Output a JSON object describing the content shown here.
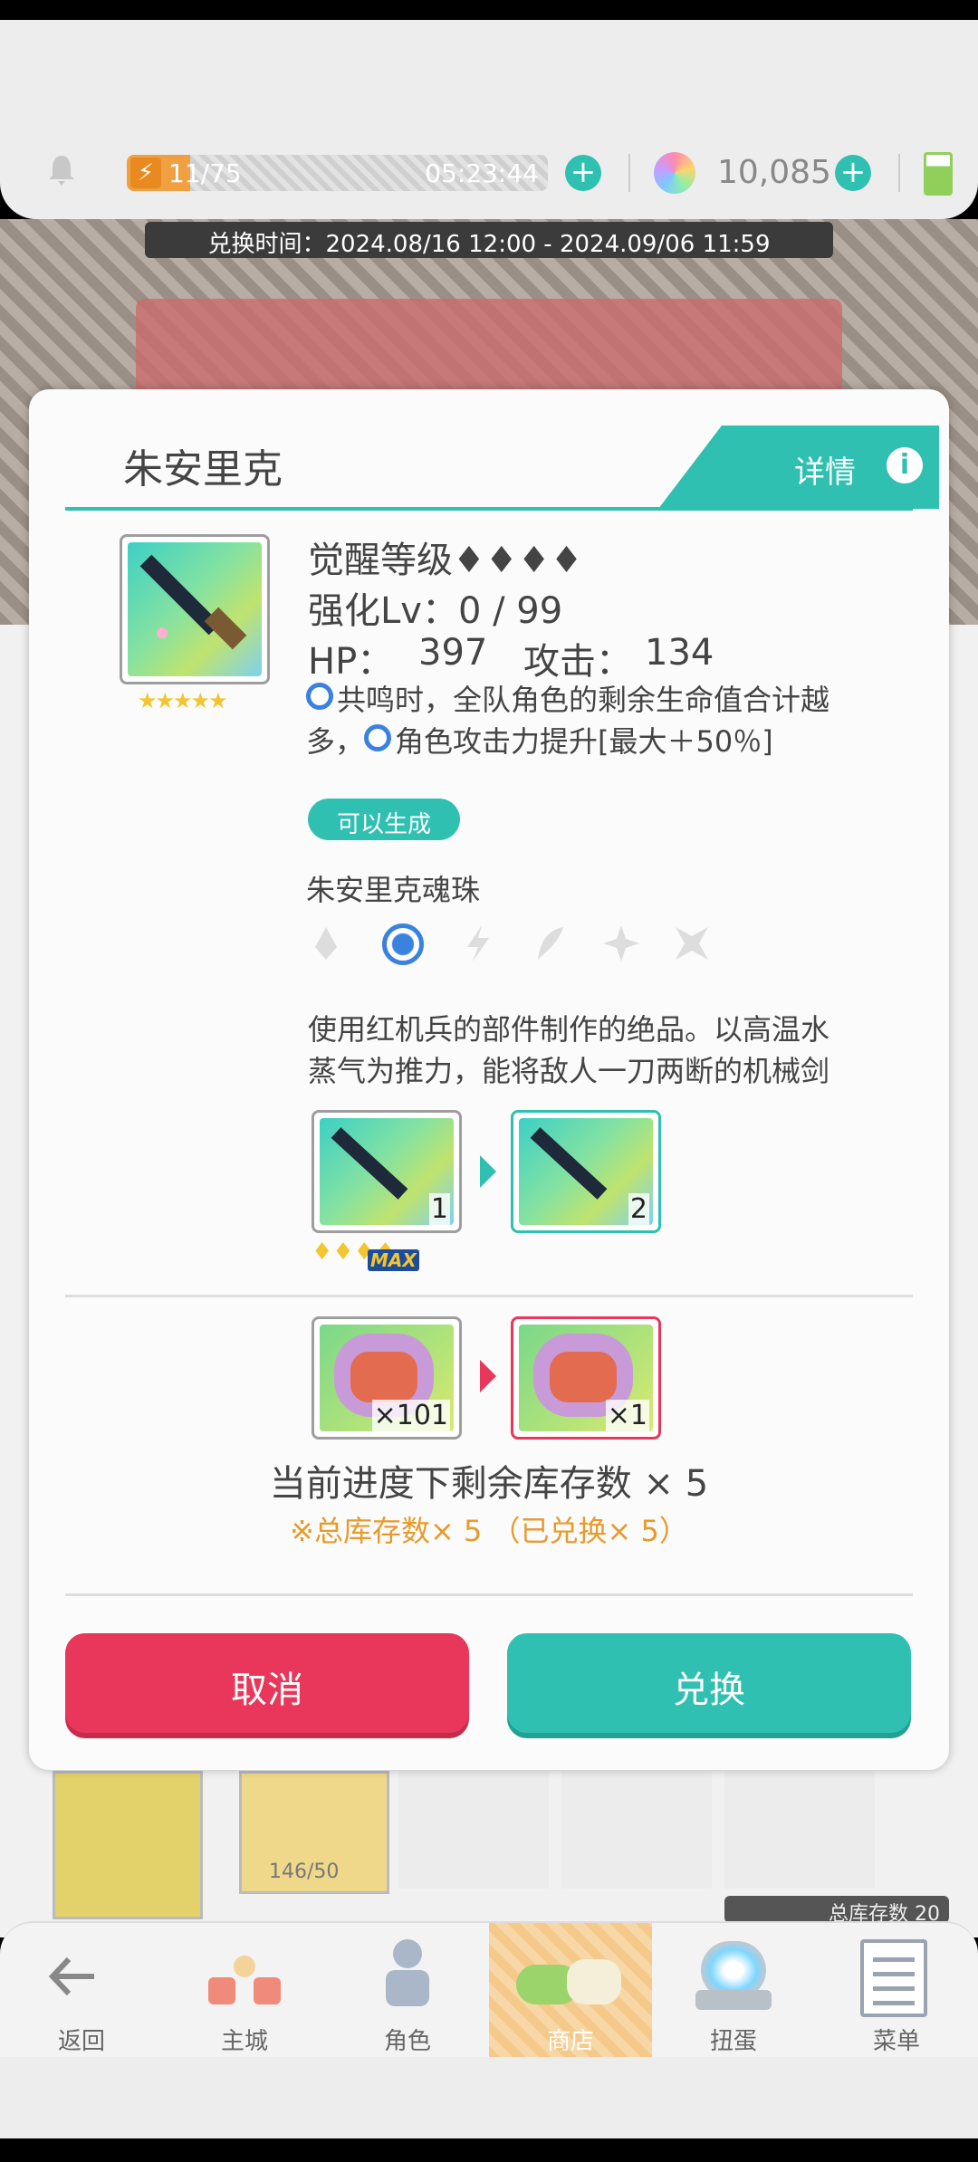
{
  "status": {
    "stamina_value": "11/75",
    "stamina_timer": "05:23:44",
    "gems_value": "10,085"
  },
  "banner": {
    "exchange_period": "兑换时间：2024.08/16 12:00 - 2024.09/06 11:59"
  },
  "dialog": {
    "title": "朱安里克",
    "detail_label": "详情",
    "awaken_label": "觉醒等级♦♦♦♦",
    "enhance_label": "强化Lv：0 / 99",
    "hp_label": "HP：",
    "hp_value": "397",
    "attack_label": "攻击：",
    "attack_value": "134",
    "effect_line1": "共鸣时，全队角色的剩余生命值合计越",
    "effect_line2_a": "多，",
    "effect_line2_b": "角色攻击力提升[最大＋50％]",
    "generate_badge": "可以生成",
    "soul_orb_label": "朱安里克魂珠",
    "desc_line1": "使用红机兵的部件制作的绝品。以高温水",
    "desc_line2": "蒸气为推力，能将敌人一刀两断的机械剑",
    "upgrade_from_count": "1",
    "upgrade_to_count": "2",
    "max_badge": "MAX",
    "material_from_count": "×101",
    "material_to_count": "×1",
    "remaining_stock": "当前进度下剩余库存数 × 5",
    "total_stock": "※总库存数× 5 （已兑换× 5）",
    "cancel_label": "取消",
    "exchange_label": "兑换"
  },
  "background": {
    "item_progress": "146/50",
    "stock_hint": "总库存数 20"
  },
  "nav": {
    "items": [
      {
        "label": "返回",
        "icon": "back-arrow-icon"
      },
      {
        "label": "主城",
        "icon": "main-city-icon"
      },
      {
        "label": "角色",
        "icon": "character-icon"
      },
      {
        "label": "商店",
        "icon": "shop-icon"
      },
      {
        "label": "扭蛋",
        "icon": "gacha-icon"
      },
      {
        "label": "菜单",
        "icon": "menu-icon"
      }
    ]
  },
  "colors": {
    "teal": "#2fc0b1",
    "red": "#e8375a",
    "orange": "#e89a2a",
    "shop_highlight": "#f5c98a"
  }
}
